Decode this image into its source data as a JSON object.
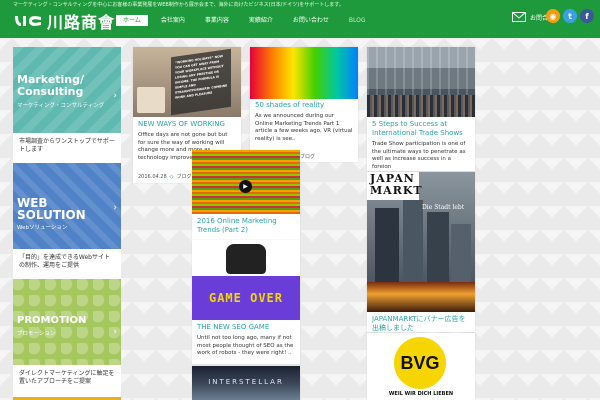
{
  "header": {
    "tagline": "マーケティング・コンサルティングを中心にお客様の事業発展をWEB制作から展示会まで、海外に向けたビジネス(日本/ドイツ)をサポートします。",
    "logo_mark": "JIC",
    "logo_text": "川路商會",
    "nav": [
      {
        "label": "ホーム",
        "active": true
      },
      {
        "label": "会社案内",
        "active": false
      },
      {
        "label": "事業内容",
        "active": false
      },
      {
        "label": "実績紹介",
        "active": false
      },
      {
        "label": "お問い合わせ",
        "active": false
      },
      {
        "label": "BLOG",
        "active": false
      }
    ],
    "contact_label": "お問合せ",
    "social": [
      {
        "icon": "rss-icon",
        "color": "#f39c12",
        "glyph": "◉"
      },
      {
        "icon": "twitter-icon",
        "color": "#3aa0e6",
        "glyph": "t"
      },
      {
        "icon": "facebook-icon",
        "color": "#3b5998",
        "glyph": "f"
      }
    ]
  },
  "colors": {
    "brand": "#1e9a3c",
    "link": "#2aa4a4"
  },
  "tiles": [
    {
      "title": "Marketing/ Consulting",
      "sub": "マーケティング・コンサルティング",
      "desc": "市場調査からワンストップでサポートします"
    },
    {
      "title": "WEB SOLUTION",
      "sub": "Webソリューション",
      "desc": "「目的」を達成できるWebサイトの制作、運用をご提供"
    },
    {
      "title": "PROMOTION",
      "sub": "プロモーション",
      "desc": "ダイレクトマーケティングに軸足を置いたアプローチをご提案"
    }
  ],
  "cards": {
    "working": {
      "img_text": "“WORKING HOLIDAYS” NOW YOU CAN GET AWAY FROM YOUR WORKPLACE WITHOUT LOSING ANY PRESTIGE OR INCOME. THE FORMULA IS SIMPLE AND STRAIGHTFORWARD: COMBINE WORK AND PLEASURE",
      "title": "NEW WAYS OF WORKING",
      "text": "Office days are not gone but but for sure the way of working will change more and more as technology improves. Sure, t..",
      "date": "2016.04.28",
      "tag": "ブログ"
    },
    "reality": {
      "title": "50 shades of reality",
      "text": "As we announced during our Online Marketing Trends Part 1 article a few weeks ago, VR (virtual reality) is see..",
      "tag": "ブログ"
    },
    "trends": {
      "title": "2016 Online Marketing Trends (Part 2)"
    },
    "seo": {
      "img_text": "GAME OVER",
      "title": "THE NEW SEO GAME",
      "text": "Until not too long ago, many if not most people thought of SEO as the work of robots - they were right! .."
    },
    "interstellar": {
      "img_text": "INTERSTELLAR"
    },
    "trade": {
      "title": "5 Steps to Success at International Trade Shows",
      "text": "Trade Show participation is one of the ultimate ways to penetrate as well as increase success in a foreign"
    },
    "japanmarkt": {
      "img_line1": "JAPAN",
      "img_line2": "MARKT",
      "img_city": "Die Stadt lebt",
      "title": "JAPANMARKTにバナー広告を出稿しました"
    },
    "bvg": {
      "logo": "BVG",
      "slogan": "WEIL WIR DICH LIEBEN"
    }
  }
}
